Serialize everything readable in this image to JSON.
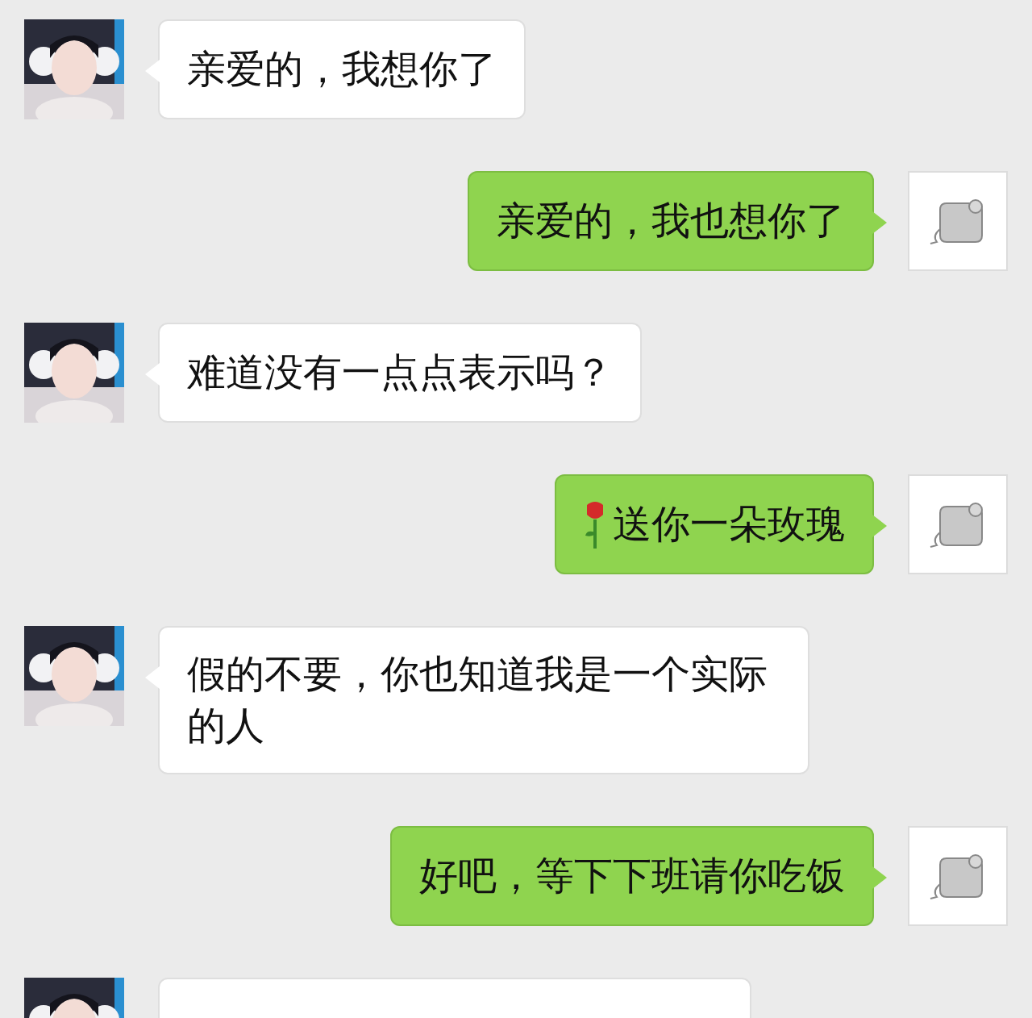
{
  "messages": [
    {
      "kind": "incoming",
      "text": "亲爱的，我想你了"
    },
    {
      "kind": "outgoing",
      "text": "亲爱的，我也想你了"
    },
    {
      "kind": "incoming",
      "text": "难道没有一点点表示吗？"
    },
    {
      "kind": "outgoing",
      "text": "送你一朵玫瑰",
      "emoji": true
    },
    {
      "kind": "incoming",
      "text": "假的不要，你也知道我是一个实际的人"
    },
    {
      "kind": "outgoing",
      "text": "好吧，等下下班请你吃饭"
    },
    {
      "kind": "incoming"
    }
  ]
}
